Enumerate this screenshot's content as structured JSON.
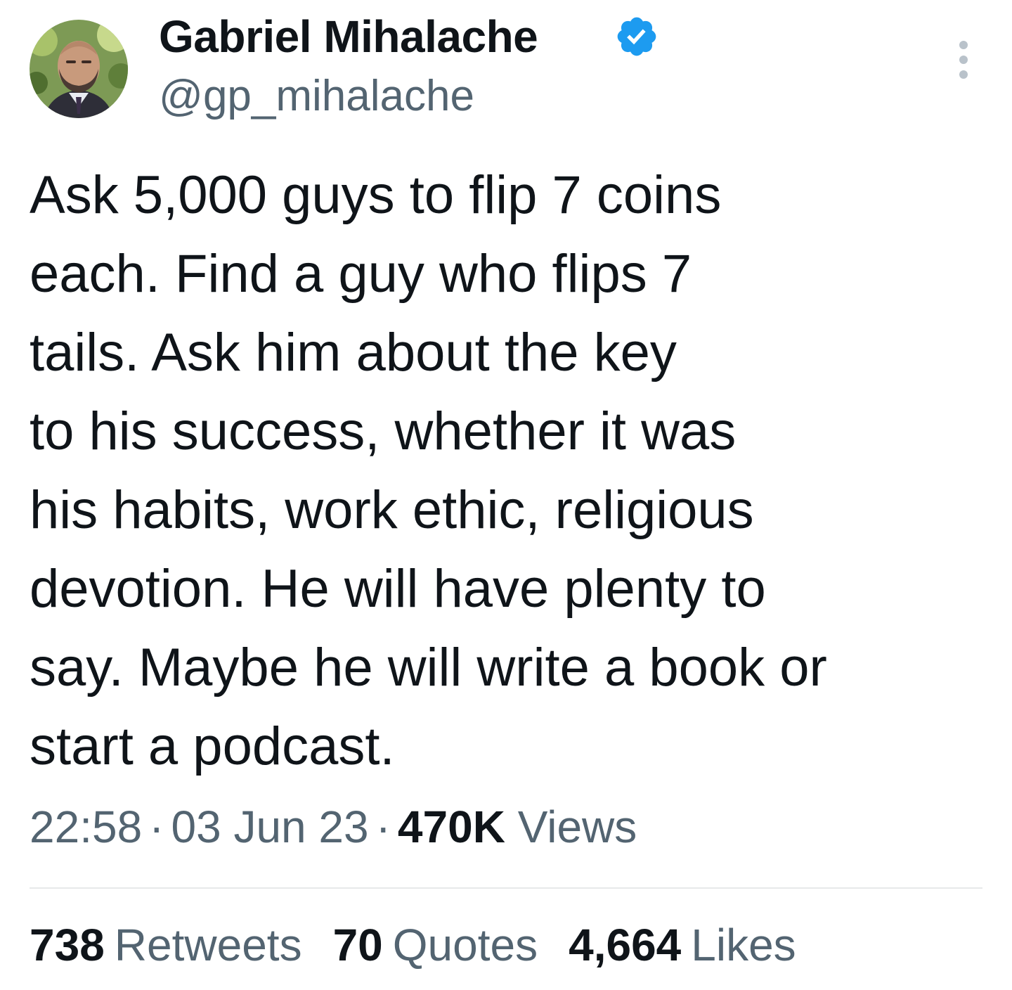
{
  "author": {
    "display_name": "Gabriel Mihalache",
    "handle": "@gp_mihalache",
    "avatar_icon": "profile-photo",
    "verified_icon": "verified-badge-icon",
    "verified_color": "#1d9bf0"
  },
  "more_icon": "more-options-vertical-icon",
  "tweet": {
    "lines": [
      "Ask 5,000 guys to flip 7 coins",
      "each. Find a guy who flips 7",
      "tails. Ask him about the key",
      "to his success, whether it was",
      "his habits, work ethic, religious",
      "devotion. He will have plenty to",
      "say. Maybe he will write a book or",
      "start a podcast."
    ]
  },
  "meta": {
    "time": "22:58",
    "separator": "·",
    "date": "03 Jun 23",
    "views_count": "470K",
    "views_label": "Views"
  },
  "stats": {
    "retweets_count": "738",
    "retweets_label": "Retweets",
    "quotes_count": "70",
    "quotes_label": "Quotes",
    "likes_count": "4,664",
    "likes_label": "Likes"
  },
  "colors": {
    "text_primary": "#0f1419",
    "text_secondary": "#536471",
    "divider": "#e7e9ea"
  }
}
